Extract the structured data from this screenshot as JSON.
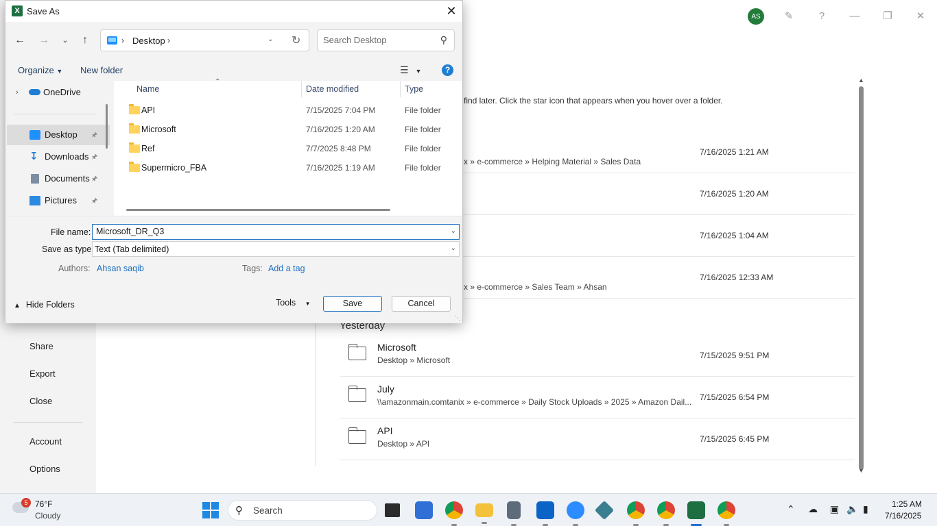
{
  "dialog": {
    "title": "Save As",
    "address": {
      "location": "Desktop"
    },
    "search": {
      "placeholder": "Search Desktop"
    },
    "commands": {
      "organize": "Organize",
      "new_folder": "New folder"
    },
    "nav_pane": [
      {
        "label": "OneDrive",
        "icon": "onedrive-icon"
      },
      {
        "label": "Desktop",
        "icon": "desktop-icon",
        "selected": true,
        "pinned": true
      },
      {
        "label": "Downloads",
        "icon": "downloads-icon",
        "pinned": true
      },
      {
        "label": "Documents",
        "icon": "documents-icon",
        "pinned": true
      },
      {
        "label": "Pictures",
        "icon": "pictures-icon",
        "pinned": true
      }
    ],
    "columns": {
      "name": "Name",
      "date": "Date modified",
      "type": "Type"
    },
    "files": [
      {
        "name": "API",
        "date": "7/15/2025 7:04 PM",
        "type": "File folder"
      },
      {
        "name": "Microsoft",
        "date": "7/16/2025 1:20 AM",
        "type": "File folder"
      },
      {
        "name": "Ref",
        "date": "7/7/2025 8:48 PM",
        "type": "File folder"
      },
      {
        "name": "Supermicro_FBA",
        "date": "7/16/2025 1:19 AM",
        "type": "File folder"
      }
    ],
    "form": {
      "file_name_label": "File name:",
      "file_name_value": "Microsoft_DR_Q3",
      "save_type_label": "Save as type:",
      "save_type_value": "Text (Tab delimited)",
      "authors_label": "Authors:",
      "authors_value": "Ahsan saqib",
      "tags_label": "Tags:",
      "tags_value": "Add a tag"
    },
    "footer": {
      "hide_folders": "Hide Folders",
      "tools": "Tools",
      "save": "Save",
      "cancel": "Cancel"
    }
  },
  "backstage": {
    "user_initials": "AS",
    "nav": [
      "Share",
      "Export",
      "Close",
      "Account",
      "Options"
    ],
    "hint": "find later. Click the star icon that appears when you hover over a folder.",
    "partial_rows": [
      {
        "path": "x » e-commerce » Helping Material » Sales Data",
        "date": "7/16/2025 1:21 AM"
      },
      {
        "path": "",
        "date": "7/16/2025 1:20 AM"
      },
      {
        "path": "",
        "date": "7/16/2025 1:04 AM"
      },
      {
        "path": "x » e-commerce » Sales Team » Ahsan",
        "date": "7/16/2025 12:33 AM"
      }
    ],
    "section_yesterday": "Yesterday",
    "yesterday_rows": [
      {
        "title": "Microsoft",
        "path": "Desktop » Microsoft",
        "date": "7/15/2025 9:51 PM"
      },
      {
        "title": "July",
        "path": "\\\\amazonmain.comtanix » e-commerce » Daily Stock Uploads » 2025 » Amazon Dail...",
        "date": "7/15/2025 6:54 PM"
      },
      {
        "title": "API",
        "path": "Desktop » API",
        "date": "7/15/2025 6:45 PM"
      }
    ]
  },
  "taskbar": {
    "weather": {
      "badge": "5",
      "temp": "76°F",
      "condition": "Cloudy"
    },
    "search_label": "Search",
    "clock": {
      "time": "1:25 AM",
      "date": "7/16/2025"
    },
    "apps": [
      "task-view",
      "microsoft-store",
      "chrome",
      "file-explorer",
      "calculator",
      "outlook",
      "zoom",
      "app",
      "chrome",
      "chrome",
      "excel",
      "chrome"
    ]
  },
  "colors": {
    "accent": "#1e6fc0",
    "excel_green": "#1d6f42",
    "avatar": "#237b3a"
  }
}
